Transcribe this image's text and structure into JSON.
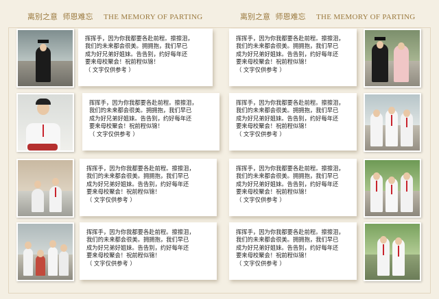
{
  "header": {
    "cn_title": "离别之意",
    "cn_sub": "师恩难忘",
    "en_title": "THE MEMORY OF PARTING"
  },
  "card_text": "挥挥手，因为你我都要各赴前程。擦擦泪，\n我们的未来都会很美。拥拥抱，我们早已\n成为好兄弟好姐妹。告告别，约好每年还\n要来母校聚会！祝前程似锦！",
  "card_note": "（ 文字仅供参考 ）",
  "photos": {
    "left": [
      "graduate-gown-photo",
      "student-red-tie-photo",
      "students-sitting-photo",
      "group-photo"
    ],
    "right": [
      "graduates-couple-photo",
      "three-students-photo",
      "students-red-ties-photo",
      "students-outdoor-photo"
    ]
  },
  "colors": {
    "background": "#f4efe3",
    "header": "#9b7a3f",
    "tie": "#c8232c"
  }
}
